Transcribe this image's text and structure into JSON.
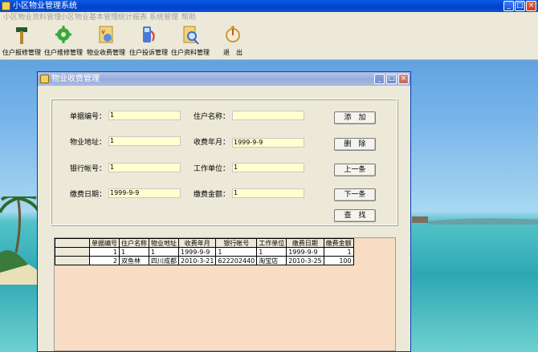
{
  "window": {
    "title": "小区物业管理系统",
    "controls": {
      "minimize": "_",
      "maximize": "□",
      "close": "×"
    }
  },
  "menu": [
    "小区物业资料管理",
    "小区物业基本管理",
    "统计报表",
    "系统管理",
    "帮助"
  ],
  "toolbar": [
    {
      "label": "住户报修管理",
      "icon": "hammer-icon"
    },
    {
      "label": "住户维修管理",
      "icon": "gear-icon"
    },
    {
      "label": "物业收费管理",
      "icon": "money-icon"
    },
    {
      "label": "住户投诉管理",
      "icon": "phone-icon"
    },
    {
      "label": "住户资料管理",
      "icon": "magnifier-icon"
    },
    {
      "label": "退　出",
      "icon": "exit-icon"
    }
  ],
  "dialog": {
    "title": "物业收费管理",
    "fields": {
      "bill_no": {
        "label": "单据编号：",
        "value": "1"
      },
      "owner_name": {
        "label": "住户名称：",
        "value": ""
      },
      "address": {
        "label": "物业地址：",
        "value": "1"
      },
      "fee_month": {
        "label": "收费年月：",
        "value": "1999-9-9"
      },
      "bank_account": {
        "label": "银行帐号：",
        "value": "1"
      },
      "work_unit": {
        "label": "工作单位：",
        "value": "1"
      },
      "pay_date": {
        "label": "缴费日期：",
        "value": "1999-9-9"
      },
      "pay_amount": {
        "label": "缴费金额：",
        "value": "1"
      }
    },
    "buttons": {
      "add": "添　加",
      "delete": "删　除",
      "prev": "上一条",
      "next": "下一条",
      "search": "查　找"
    },
    "grid": {
      "columns": [
        "单据编号",
        "住户名称",
        "物业地址",
        "收费年月",
        "银行帐号",
        "工作单位",
        "缴费日期",
        "缴费金额"
      ],
      "rows": [
        [
          "1",
          "1",
          "1",
          "1999-9-9",
          "1",
          "1",
          "1999-9-9",
          "1"
        ],
        [
          "2",
          "双鱼林",
          "四川成都",
          "2010-3-21",
          "622202440",
          "淘宝店",
          "2010-3-25",
          "100"
        ]
      ]
    }
  },
  "colors": {
    "input_bg": "#ffffd0",
    "grid_bg": "#f9dcc4",
    "title_blue": "#0041c8"
  }
}
